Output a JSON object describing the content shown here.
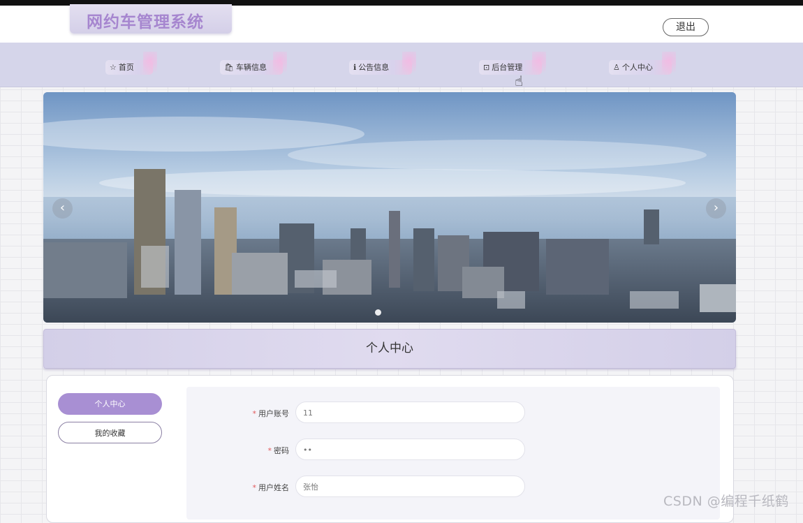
{
  "app": {
    "title": "网约车管理系统",
    "logout_label": "退出"
  },
  "nav": {
    "items": [
      {
        "icon": "star-icon",
        "label": "首页"
      },
      {
        "icon": "bag-icon",
        "label": "车辆信息"
      },
      {
        "icon": "info-icon",
        "label": "公告信息"
      },
      {
        "icon": "briefcase-icon",
        "label": "后台管理"
      },
      {
        "icon": "user-icon",
        "label": "个人中心"
      }
    ]
  },
  "carousel": {
    "image": "city skyline aerial view",
    "prev_label": "‹",
    "next_label": "›",
    "active_indicator": 1
  },
  "page": {
    "title": "个人中心"
  },
  "sidebar": {
    "items": [
      {
        "label": "个人中心",
        "active": true
      },
      {
        "label": "我的收藏",
        "active": false
      }
    ]
  },
  "form": {
    "fields": [
      {
        "label": "用户账号",
        "required": true,
        "value": "11"
      },
      {
        "label": "密码",
        "required": true,
        "value": "••"
      },
      {
        "label": "用户姓名",
        "required": true,
        "value": "张怡"
      }
    ]
  },
  "watermark": "CSDN @编程千纸鹤",
  "colors": {
    "accent": "#a88fd3",
    "nav_bg": "#d5d5ea",
    "title_text": "#a686cf"
  }
}
